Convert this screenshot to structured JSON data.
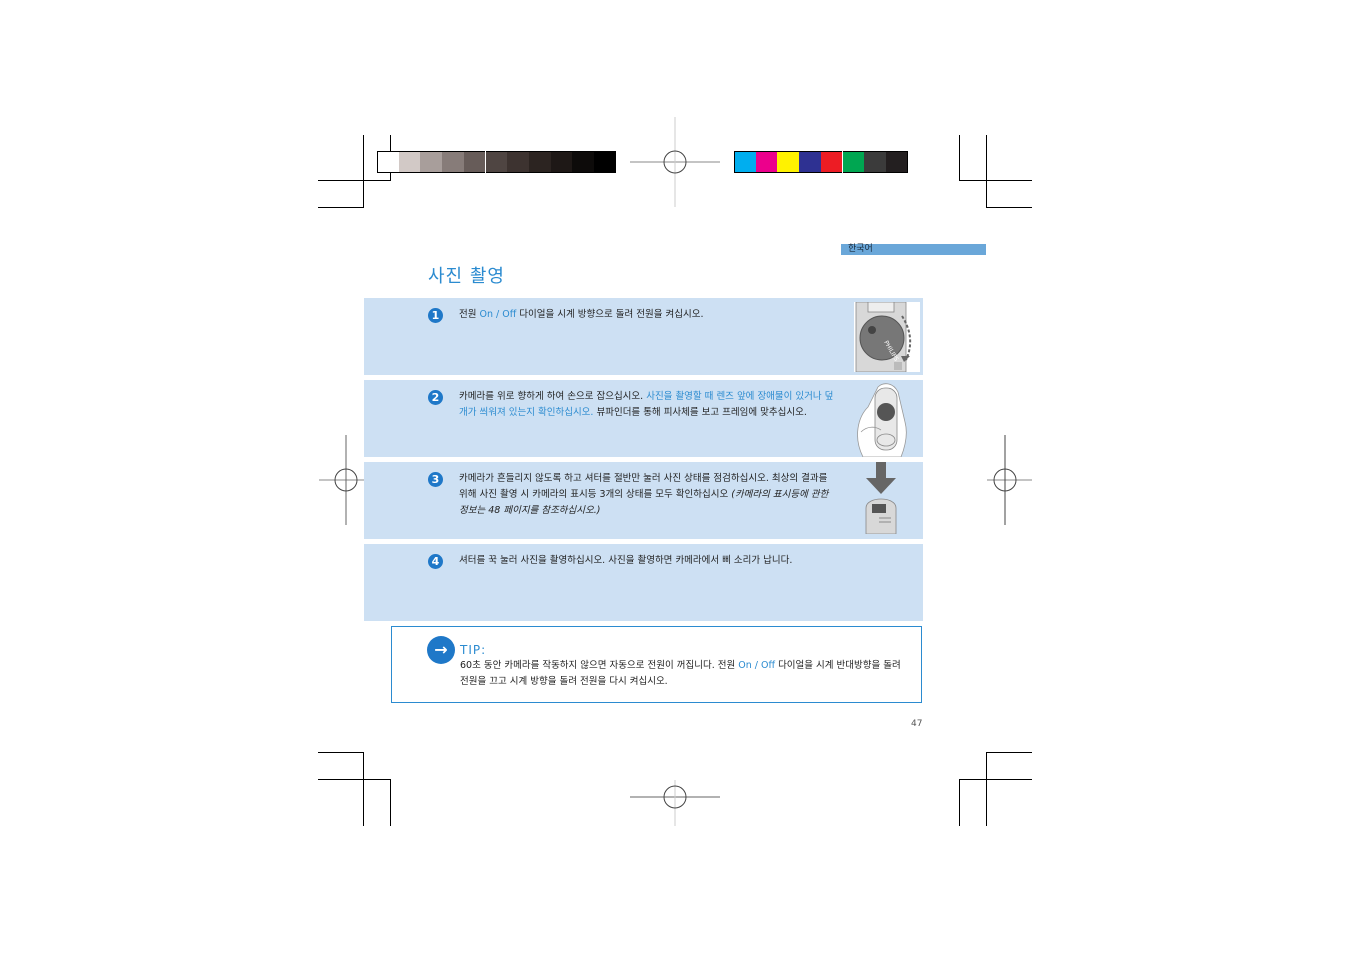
{
  "print_marks": {
    "grayscale_swatches": [
      "#ffffff",
      "#d2c9c6",
      "#a89e9b",
      "#877c79",
      "#675c59",
      "#4f4542",
      "#3d3330",
      "#2c2421",
      "#1e1816",
      "#0d0b0a",
      "#000000"
    ],
    "color_swatches": [
      "#00aeef",
      "#ec008c",
      "#fff200",
      "#2e3192",
      "#ed1c24",
      "#00a651",
      "#3b3b3b",
      "#231f20"
    ]
  },
  "header": {
    "language_tab": "한국어",
    "title": "사진 촬영"
  },
  "steps": [
    {
      "number": "1",
      "segments": [
        {
          "text": "전원 ",
          "style": "normal"
        },
        {
          "text": "On / Off",
          "style": "highlight"
        },
        {
          "text": " 다이얼을 시계 방향으로 돌려 전원을 켜십시오.",
          "style": "normal"
        }
      ],
      "image": "camera-dial-illustration"
    },
    {
      "number": "2",
      "segments": [
        {
          "text": "카메라를 위로 향하게 하여 손으로 잡으십시오. ",
          "style": "normal"
        },
        {
          "text": "사진을 촬영할 때 렌즈 앞에 장애물이 있거나 덮개가 씌워져 있는지 확인하십시오.",
          "style": "highlight"
        },
        {
          "text": " 뷰파인더를 통해 피사체를 보고 프레임에 맞추십시오.",
          "style": "normal"
        }
      ],
      "image": "hand-holding-camera-illustration"
    },
    {
      "number": "3",
      "segments": [
        {
          "text": "카메라가 흔들리지 않도록 하고 셔터를 절반만 눌러 사진 상태를 점검하십시오. 최상의 결과를 위해 사진 촬영 시 카메라의 표시등 3개의 상태를 모두 확인하십시오 ",
          "style": "normal"
        },
        {
          "text": "(카메라의 표시등에 관한 정보는 48 페이지를 참조하십시오.)",
          "style": "italic"
        }
      ],
      "image": "press-shutter-illustration"
    },
    {
      "number": "4",
      "segments": [
        {
          "text": "셔터를 꾹 눌러 사진을 촬영하십시오. 사진을 촬영하면 카메라에서 삐 소리가 납니다.",
          "style": "normal"
        }
      ],
      "image": null
    }
  ],
  "tip": {
    "icon": "arrow-right-icon",
    "heading": "TIP:",
    "segments": [
      {
        "text": "60초 동안 카메라를 작동하지 않으면 자동으로 전원이 꺼집니다. 전원  ",
        "style": "normal"
      },
      {
        "text": "On / Off",
        "style": "highlight"
      },
      {
        "text": " 다이얼을 시계 반대방향을 돌려 전원을 끄고 시계 방향을 돌려 전원을 다시 켜십시오.",
        "style": "normal"
      }
    ]
  },
  "footer": {
    "page_number": "47"
  }
}
